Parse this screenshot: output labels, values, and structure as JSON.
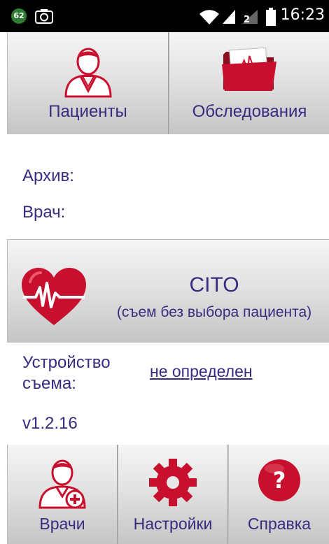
{
  "status_bar": {
    "notification_count": "62",
    "time": "16:23",
    "sim_badge": "2"
  },
  "top_buttons": {
    "patients_label": "Пациенты",
    "exams_label": "Обследования"
  },
  "info": {
    "archive_label": "Архив:",
    "doctor_label": "Врач:"
  },
  "cito": {
    "title": "CITO",
    "subtitle": "(съем без выбора пациента)"
  },
  "device": {
    "label_line1": "Устройство",
    "label_line2": "съема:",
    "value": "не определен"
  },
  "version": "v1.2.16",
  "bottom_buttons": {
    "doctors_label": "Врачи",
    "settings_label": "Настройки",
    "help_label": "Справка"
  },
  "colors": {
    "accent": "#c8102e",
    "text": "#3a2a80"
  }
}
